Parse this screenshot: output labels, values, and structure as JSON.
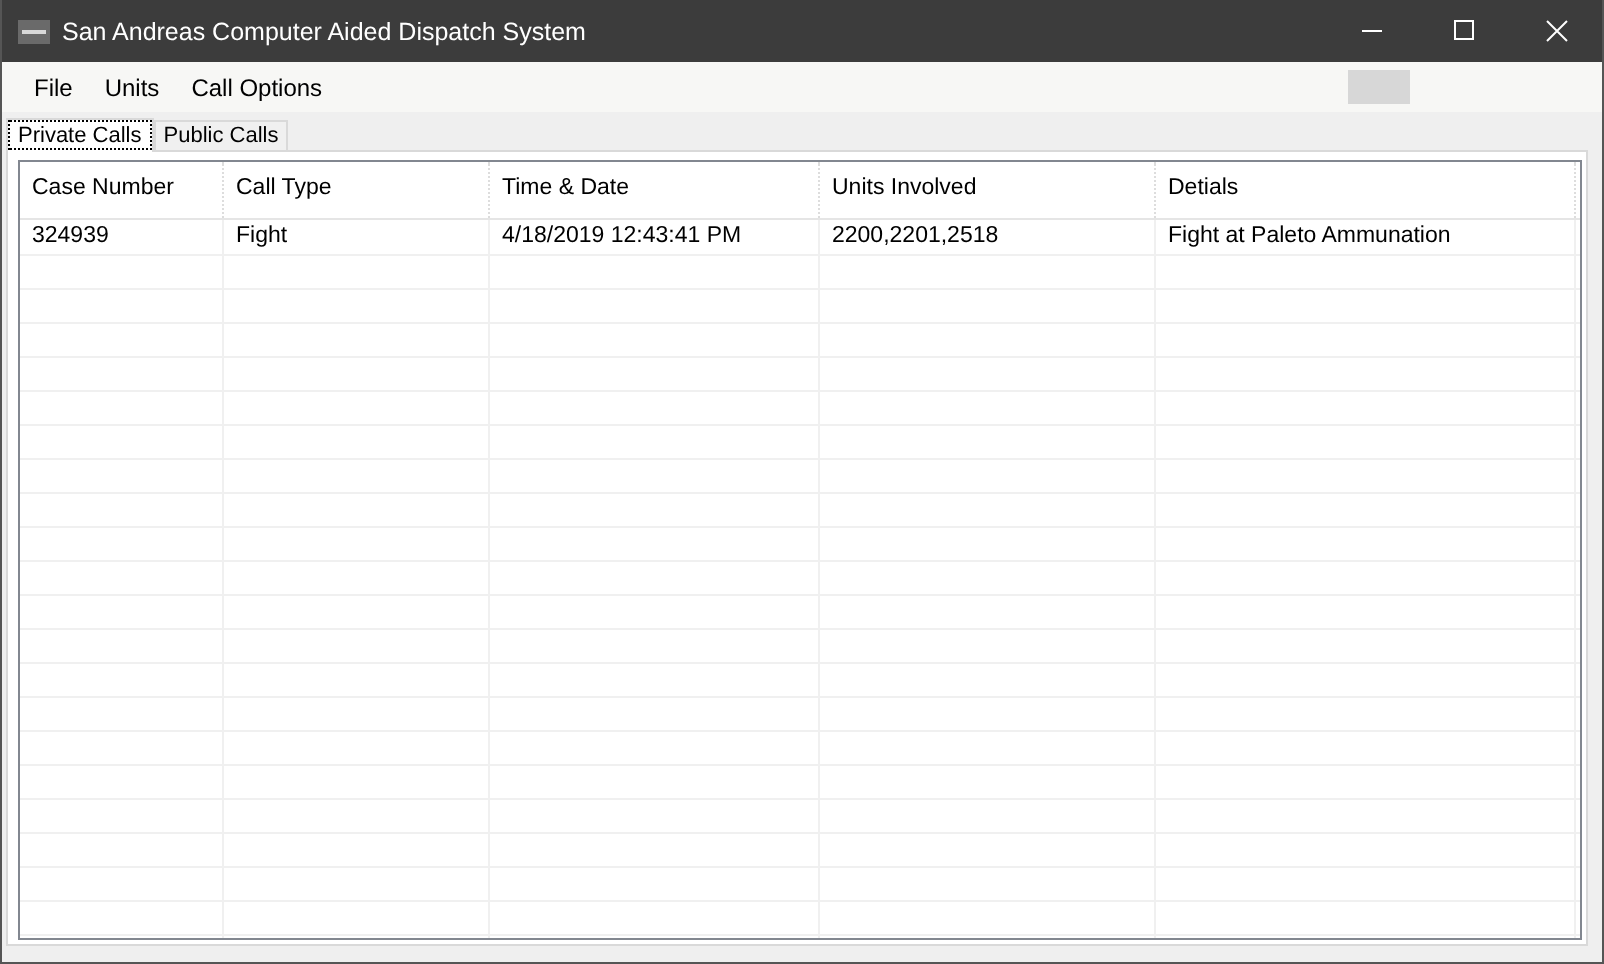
{
  "window": {
    "title": "San Andreas Computer Aided Dispatch System"
  },
  "menu": [
    {
      "label": "File"
    },
    {
      "label": "Units"
    },
    {
      "label": "Call Options"
    }
  ],
  "tabs": [
    {
      "label": "Private Calls",
      "selected": true
    },
    {
      "label": "Public Calls",
      "selected": false
    }
  ],
  "table": {
    "columns": [
      "Case Number",
      "Call Type",
      "Time & Date",
      "Units Involved",
      "Detials"
    ],
    "rows": [
      [
        "324939",
        "Fight",
        "4/18/2019 12:43:41 PM",
        "2200,2201,2518",
        "Fight at Paleto Ammunation"
      ]
    ]
  }
}
